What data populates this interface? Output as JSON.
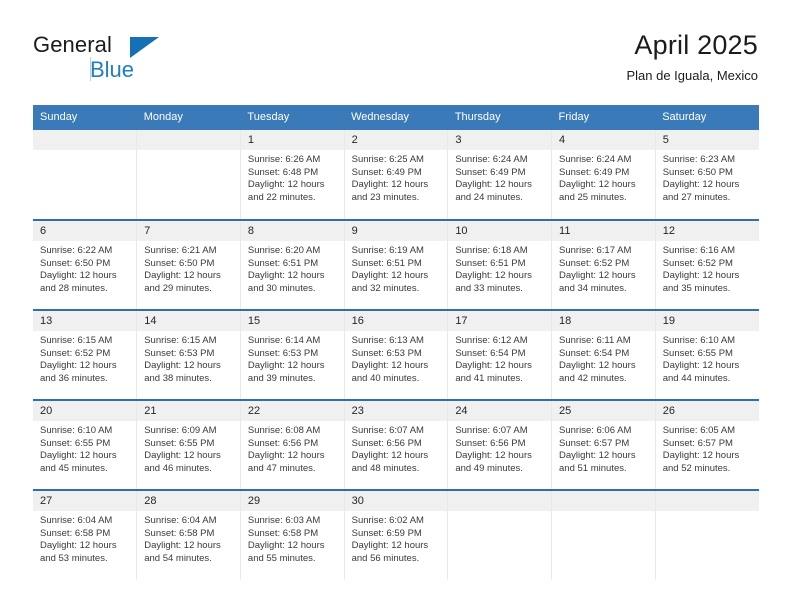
{
  "logo": {
    "word_top": "General",
    "word_bottom": "Blue",
    "triangle_icon": "logo-triangle-icon",
    "accent_color": "#1570b8"
  },
  "header": {
    "title": "April 2025",
    "subtitle": "Plan de Iguala, Mexico"
  },
  "theme": {
    "header_blue": "#3b7ab8",
    "row_divider_blue": "#2f6fad",
    "daynum_band": "#f0f0f0"
  },
  "weekday_headers": [
    "Sunday",
    "Monday",
    "Tuesday",
    "Wednesday",
    "Thursday",
    "Friday",
    "Saturday"
  ],
  "labels": {
    "sunrise_prefix": "Sunrise:",
    "sunset_prefix": "Sunset:",
    "daylight_prefix": "Daylight:"
  },
  "weeks": [
    [
      {
        "day": "",
        "l1": "",
        "l2": "",
        "l3": "",
        "l4": ""
      },
      {
        "day": "",
        "l1": "",
        "l2": "",
        "l3": "",
        "l4": ""
      },
      {
        "day": "1",
        "l1": "Sunrise: 6:26 AM",
        "l2": "Sunset: 6:48 PM",
        "l3": "Daylight: 12 hours",
        "l4": "and 22 minutes."
      },
      {
        "day": "2",
        "l1": "Sunrise: 6:25 AM",
        "l2": "Sunset: 6:49 PM",
        "l3": "Daylight: 12 hours",
        "l4": "and 23 minutes."
      },
      {
        "day": "3",
        "l1": "Sunrise: 6:24 AM",
        "l2": "Sunset: 6:49 PM",
        "l3": "Daylight: 12 hours",
        "l4": "and 24 minutes."
      },
      {
        "day": "4",
        "l1": "Sunrise: 6:24 AM",
        "l2": "Sunset: 6:49 PM",
        "l3": "Daylight: 12 hours",
        "l4": "and 25 minutes."
      },
      {
        "day": "5",
        "l1": "Sunrise: 6:23 AM",
        "l2": "Sunset: 6:50 PM",
        "l3": "Daylight: 12 hours",
        "l4": "and 27 minutes."
      }
    ],
    [
      {
        "day": "6",
        "l1": "Sunrise: 6:22 AM",
        "l2": "Sunset: 6:50 PM",
        "l3": "Daylight: 12 hours",
        "l4": "and 28 minutes."
      },
      {
        "day": "7",
        "l1": "Sunrise: 6:21 AM",
        "l2": "Sunset: 6:50 PM",
        "l3": "Daylight: 12 hours",
        "l4": "and 29 minutes."
      },
      {
        "day": "8",
        "l1": "Sunrise: 6:20 AM",
        "l2": "Sunset: 6:51 PM",
        "l3": "Daylight: 12 hours",
        "l4": "and 30 minutes."
      },
      {
        "day": "9",
        "l1": "Sunrise: 6:19 AM",
        "l2": "Sunset: 6:51 PM",
        "l3": "Daylight: 12 hours",
        "l4": "and 32 minutes."
      },
      {
        "day": "10",
        "l1": "Sunrise: 6:18 AM",
        "l2": "Sunset: 6:51 PM",
        "l3": "Daylight: 12 hours",
        "l4": "and 33 minutes."
      },
      {
        "day": "11",
        "l1": "Sunrise: 6:17 AM",
        "l2": "Sunset: 6:52 PM",
        "l3": "Daylight: 12 hours",
        "l4": "and 34 minutes."
      },
      {
        "day": "12",
        "l1": "Sunrise: 6:16 AM",
        "l2": "Sunset: 6:52 PM",
        "l3": "Daylight: 12 hours",
        "l4": "and 35 minutes."
      }
    ],
    [
      {
        "day": "13",
        "l1": "Sunrise: 6:15 AM",
        "l2": "Sunset: 6:52 PM",
        "l3": "Daylight: 12 hours",
        "l4": "and 36 minutes."
      },
      {
        "day": "14",
        "l1": "Sunrise: 6:15 AM",
        "l2": "Sunset: 6:53 PM",
        "l3": "Daylight: 12 hours",
        "l4": "and 38 minutes."
      },
      {
        "day": "15",
        "l1": "Sunrise: 6:14 AM",
        "l2": "Sunset: 6:53 PM",
        "l3": "Daylight: 12 hours",
        "l4": "and 39 minutes."
      },
      {
        "day": "16",
        "l1": "Sunrise: 6:13 AM",
        "l2": "Sunset: 6:53 PM",
        "l3": "Daylight: 12 hours",
        "l4": "and 40 minutes."
      },
      {
        "day": "17",
        "l1": "Sunrise: 6:12 AM",
        "l2": "Sunset: 6:54 PM",
        "l3": "Daylight: 12 hours",
        "l4": "and 41 minutes."
      },
      {
        "day": "18",
        "l1": "Sunrise: 6:11 AM",
        "l2": "Sunset: 6:54 PM",
        "l3": "Daylight: 12 hours",
        "l4": "and 42 minutes."
      },
      {
        "day": "19",
        "l1": "Sunrise: 6:10 AM",
        "l2": "Sunset: 6:55 PM",
        "l3": "Daylight: 12 hours",
        "l4": "and 44 minutes."
      }
    ],
    [
      {
        "day": "20",
        "l1": "Sunrise: 6:10 AM",
        "l2": "Sunset: 6:55 PM",
        "l3": "Daylight: 12 hours",
        "l4": "and 45 minutes."
      },
      {
        "day": "21",
        "l1": "Sunrise: 6:09 AM",
        "l2": "Sunset: 6:55 PM",
        "l3": "Daylight: 12 hours",
        "l4": "and 46 minutes."
      },
      {
        "day": "22",
        "l1": "Sunrise: 6:08 AM",
        "l2": "Sunset: 6:56 PM",
        "l3": "Daylight: 12 hours",
        "l4": "and 47 minutes."
      },
      {
        "day": "23",
        "l1": "Sunrise: 6:07 AM",
        "l2": "Sunset: 6:56 PM",
        "l3": "Daylight: 12 hours",
        "l4": "and 48 minutes."
      },
      {
        "day": "24",
        "l1": "Sunrise: 6:07 AM",
        "l2": "Sunset: 6:56 PM",
        "l3": "Daylight: 12 hours",
        "l4": "and 49 minutes."
      },
      {
        "day": "25",
        "l1": "Sunrise: 6:06 AM",
        "l2": "Sunset: 6:57 PM",
        "l3": "Daylight: 12 hours",
        "l4": "and 51 minutes."
      },
      {
        "day": "26",
        "l1": "Sunrise: 6:05 AM",
        "l2": "Sunset: 6:57 PM",
        "l3": "Daylight: 12 hours",
        "l4": "and 52 minutes."
      }
    ],
    [
      {
        "day": "27",
        "l1": "Sunrise: 6:04 AM",
        "l2": "Sunset: 6:58 PM",
        "l3": "Daylight: 12 hours",
        "l4": "and 53 minutes."
      },
      {
        "day": "28",
        "l1": "Sunrise: 6:04 AM",
        "l2": "Sunset: 6:58 PM",
        "l3": "Daylight: 12 hours",
        "l4": "and 54 minutes."
      },
      {
        "day": "29",
        "l1": "Sunrise: 6:03 AM",
        "l2": "Sunset: 6:58 PM",
        "l3": "Daylight: 12 hours",
        "l4": "and 55 minutes."
      },
      {
        "day": "30",
        "l1": "Sunrise: 6:02 AM",
        "l2": "Sunset: 6:59 PM",
        "l3": "Daylight: 12 hours",
        "l4": "and 56 minutes."
      },
      {
        "day": "",
        "l1": "",
        "l2": "",
        "l3": "",
        "l4": ""
      },
      {
        "day": "",
        "l1": "",
        "l2": "",
        "l3": "",
        "l4": ""
      },
      {
        "day": "",
        "l1": "",
        "l2": "",
        "l3": "",
        "l4": ""
      }
    ]
  ]
}
